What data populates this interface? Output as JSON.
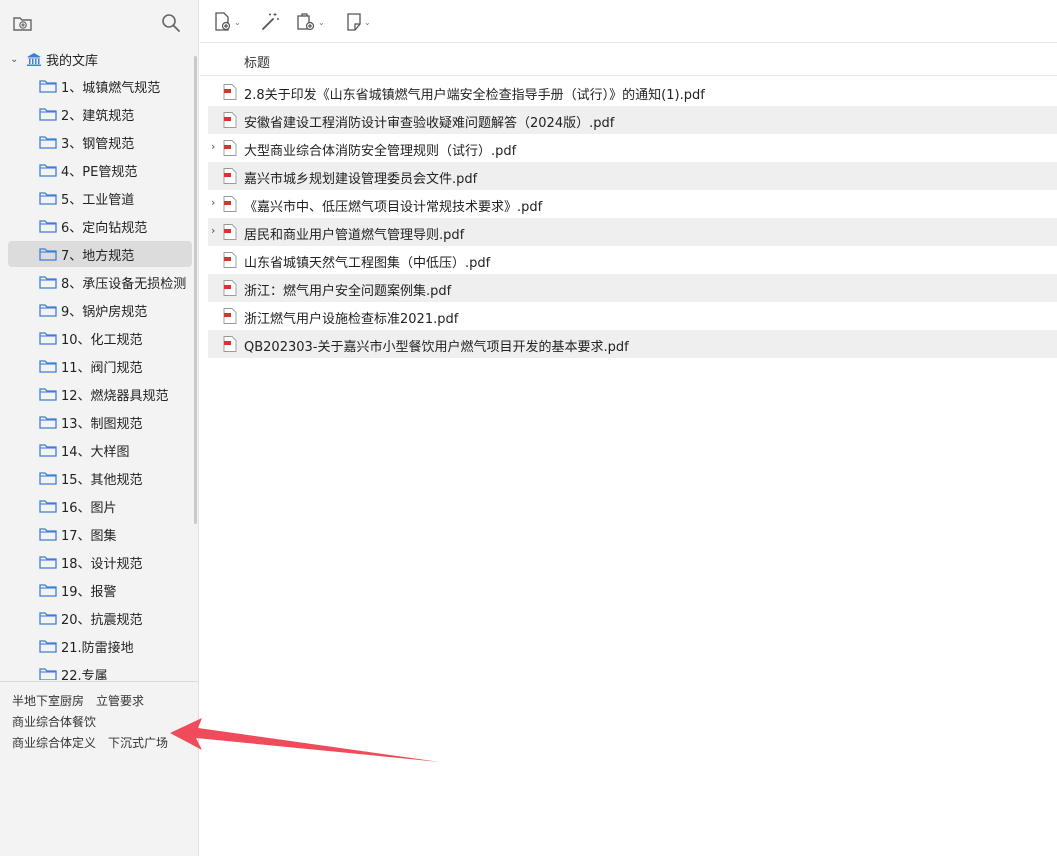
{
  "sidebar": {
    "toolbar": {
      "new_folder_icon": "folder-add-icon",
      "search_icon": "search-icon"
    },
    "library": {
      "label": "我的文库",
      "icon": "library-icon",
      "expanded": true
    },
    "folders": [
      {
        "label": "1、城镇燃气规范"
      },
      {
        "label": "2、建筑规范"
      },
      {
        "label": "3、钢管规范"
      },
      {
        "label": "4、PE管规范"
      },
      {
        "label": "5、工业管道"
      },
      {
        "label": "6、定向钻规范"
      },
      {
        "label": "7、地方规范",
        "selected": true
      },
      {
        "label": "8、承压设备无损检测"
      },
      {
        "label": "9、锅炉房规范"
      },
      {
        "label": "10、化工规范"
      },
      {
        "label": "11、阀门规范"
      },
      {
        "label": "12、燃烧器具规范"
      },
      {
        "label": "13、制图规范"
      },
      {
        "label": "14、大样图"
      },
      {
        "label": "15、其他规范"
      },
      {
        "label": "16、图片"
      },
      {
        "label": "17、图集"
      },
      {
        "label": "18、设计规范"
      },
      {
        "label": "19、报警"
      },
      {
        "label": "20、抗震规范"
      },
      {
        "label": "21.防雷接地"
      },
      {
        "label": "22.专属"
      }
    ],
    "tags": [
      [
        "半地下室厨房",
        "立管要求"
      ],
      [
        "商业综合体餐饮"
      ],
      [
        "商业综合体定义",
        "下沉式广场"
      ]
    ]
  },
  "toolbar": {
    "buttons": [
      {
        "icon": "add-item-icon",
        "has_dropdown": true
      },
      {
        "icon": "magic-wand-icon",
        "has_dropdown": false
      },
      {
        "icon": "add-attachment-icon",
        "has_dropdown": true
      },
      {
        "icon": "note-icon",
        "has_dropdown": true
      }
    ]
  },
  "list": {
    "column_title": "标题",
    "rows": [
      {
        "title": "2.8关于印发《山东省城镇燃气用户端安全检查指导手册（试行）》的通知(1).pdf",
        "expandable": false
      },
      {
        "title": "安徽省建设工程消防设计审查验收疑难问题解答（2024版）.pdf",
        "expandable": false
      },
      {
        "title": "大型商业综合体消防安全管理规则（试行）.pdf",
        "expandable": true
      },
      {
        "title": "嘉兴市城乡规划建设管理委员会文件.pdf",
        "expandable": false
      },
      {
        "title": "《嘉兴市中、低压燃气项目设计常规技术要求》.pdf",
        "expandable": true
      },
      {
        "title": "居民和商业用户管道燃气管理导则.pdf",
        "expandable": true
      },
      {
        "title": "山东省城镇天然气工程图集（中低压）.pdf",
        "expandable": false
      },
      {
        "title": "浙江：燃气用户安全问题案例集.pdf",
        "expandable": false
      },
      {
        "title": "浙江燃气用户设施检查标准2021.pdf",
        "expandable": false
      },
      {
        "title": "QB202303-关于嘉兴市小型餐饮用户燃气项目开发的基本要求.pdf",
        "expandable": false
      }
    ]
  },
  "colors": {
    "folder": "#3d7fd6",
    "pdf_red": "#d9332b",
    "arrow": "#ef4b5a",
    "selected": "#dcdcdc"
  }
}
